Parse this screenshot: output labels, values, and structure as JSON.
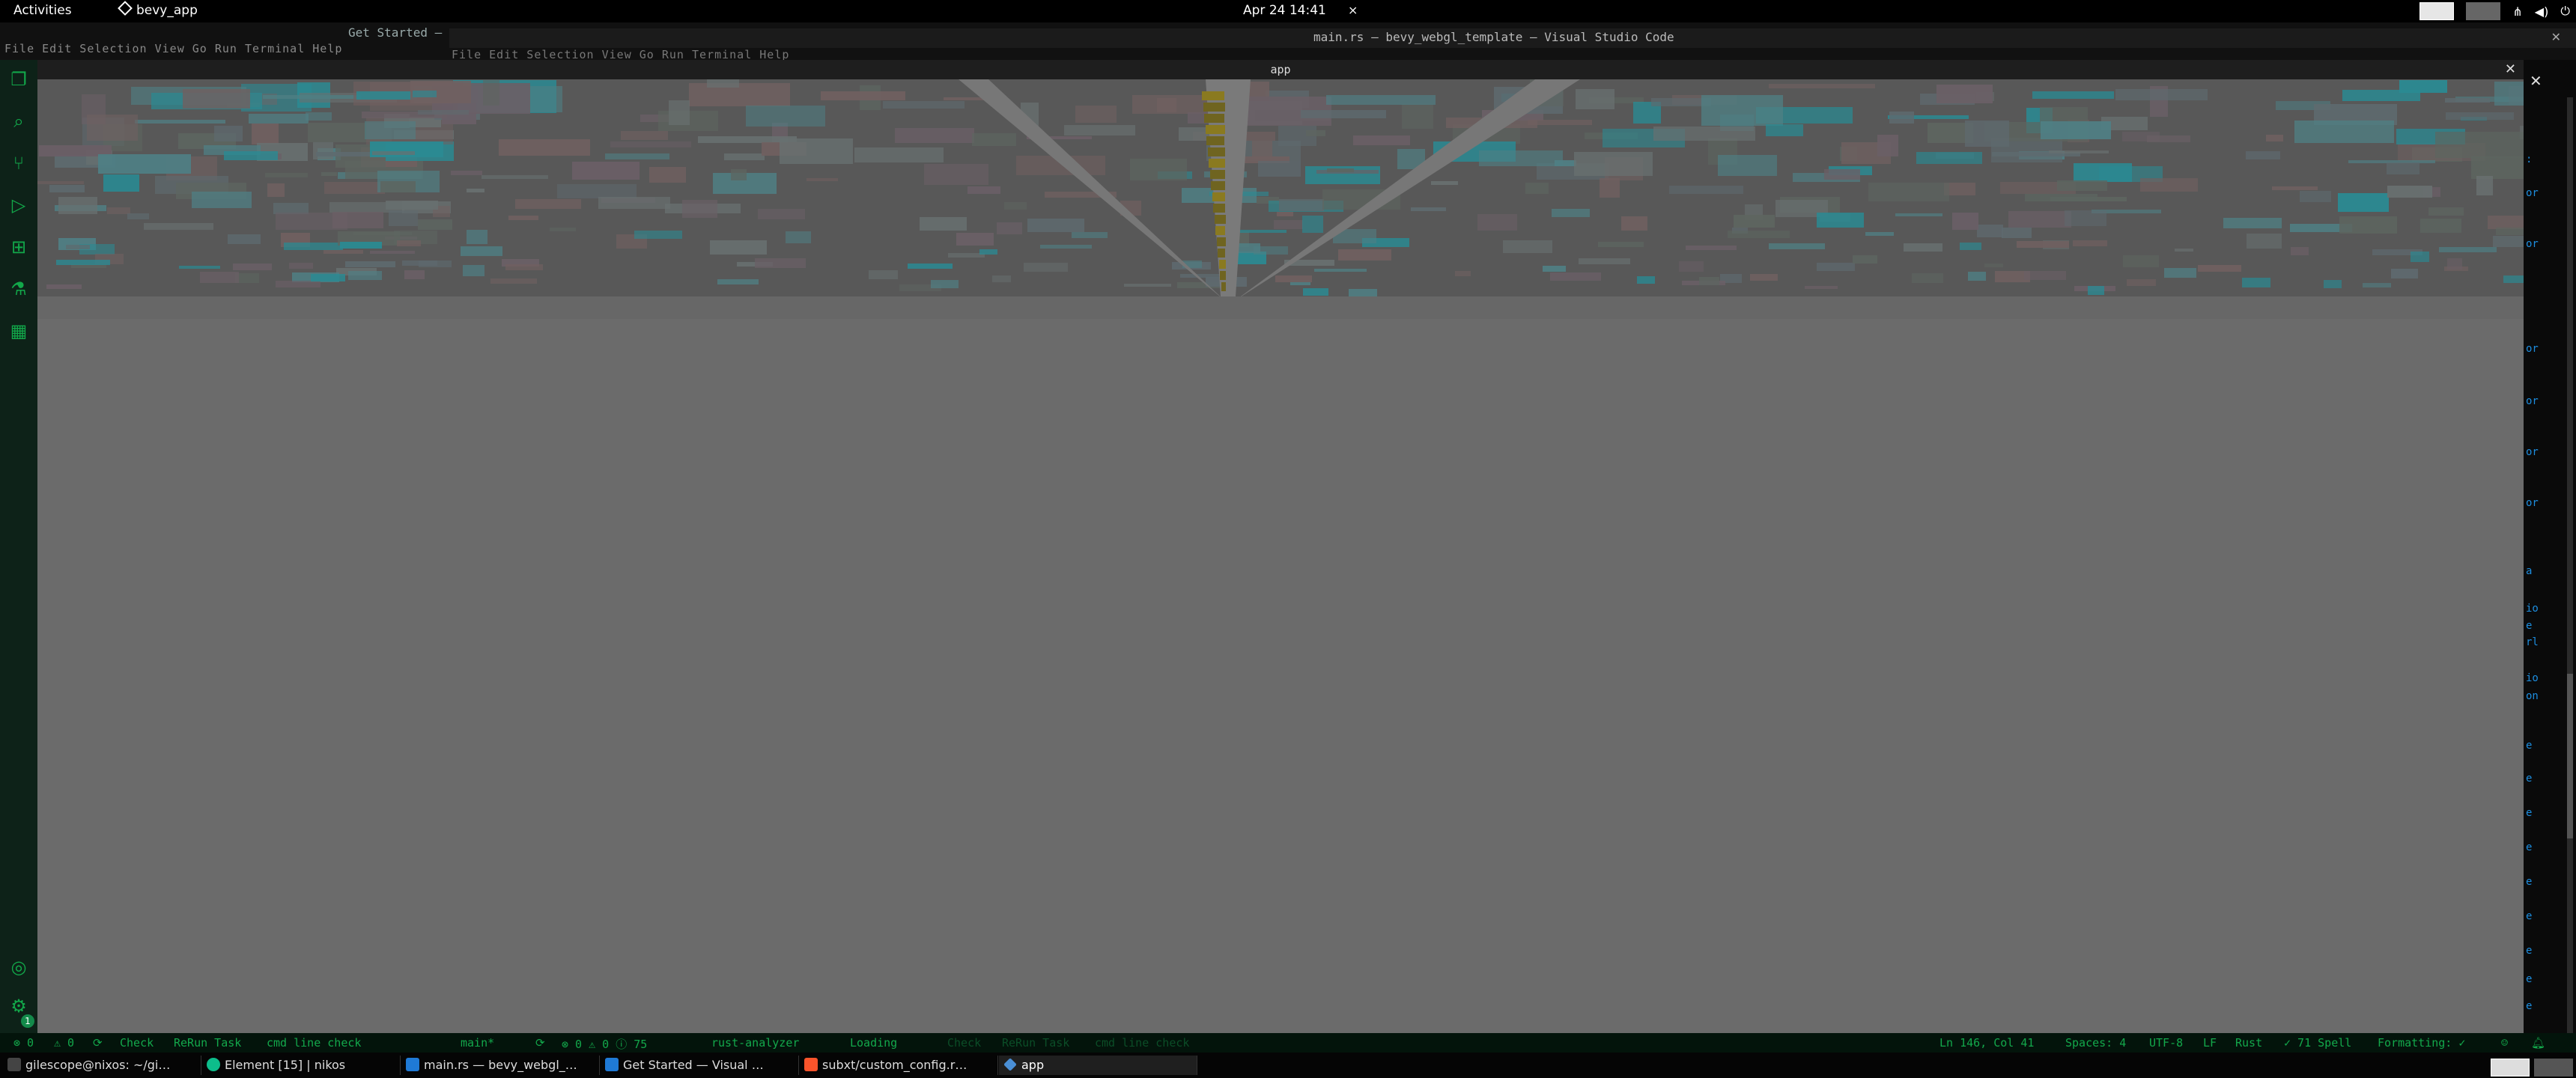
{
  "topbar": {
    "activities": "Activities",
    "app_menu": "bevy_app",
    "clock": "Apr 24 14:41"
  },
  "vscode_back": {
    "title": "Get Started —",
    "menu": "File  Edit  Selection  View  Go  Run  Terminal  Help"
  },
  "vscode_front": {
    "title": "main.rs — bevy_webgl_template — Visual Studio Code",
    "menu": "File  Edit  Selection  View  Go  Run  Terminal  Help"
  },
  "app_window": {
    "title": "app"
  },
  "activity_bar": {
    "items": [
      {
        "name": "explorer-icon",
        "glyph": "❐"
      },
      {
        "name": "search-icon",
        "glyph": "⌕"
      },
      {
        "name": "source-control-icon",
        "glyph": "⑂"
      },
      {
        "name": "run-debug-icon",
        "glyph": "▷"
      },
      {
        "name": "extensions-icon",
        "glyph": "⊞"
      },
      {
        "name": "testing-icon",
        "glyph": "⚗"
      },
      {
        "name": "remote-icon",
        "glyph": "▦"
      }
    ],
    "account_glyph": "◎",
    "settings_glyph": "⚙",
    "settings_badge": "1"
  },
  "status_bar": {
    "errors": "⊗ 0",
    "warnings": "⚠ 0",
    "check": "Check",
    "rerun": "ReRun Task",
    "cmd_check": "cmd line check",
    "branch": "main*",
    "sync": "⟳",
    "problems": "⊗ 0 ⚠ 0 ⓘ 75",
    "rust_analyzer": "rust-analyzer",
    "loading": "Loading",
    "check_faint": "Check",
    "rerun_faint": "ReRun Task",
    "cmd_faint": "cmd line check",
    "position": "Ln 146, Col 41",
    "spaces": "Spaces: 4",
    "encoding": "UTF-8",
    "eol": "LF",
    "language": "Rust",
    "spell": "✓ 71 Spell",
    "formatting": "Formatting: ✓"
  },
  "taskbar": {
    "items": [
      {
        "label": "gilescope@nixos: ~/gi…",
        "icon_color": "#444",
        "icon": "terminal-icon"
      },
      {
        "label": "Element [15] | nikos",
        "icon_color": "#0dbd8b",
        "icon": "element-icon"
      },
      {
        "label": "main.rs — bevy_webgl_…",
        "icon_color": "#1f7ad6",
        "icon": "vscode-icon"
      },
      {
        "label": "Get Started — Visual …",
        "icon_color": "#1f7ad6",
        "icon": "vscode-icon"
      },
      {
        "label": "subxt/custom_config.r…",
        "icon_color": "#fb542b",
        "icon": "brave-icon"
      },
      {
        "label": "app",
        "icon_color": "#4a8fd6",
        "icon": "app-icon"
      }
    ]
  },
  "right_code": [
    ":",
    "or",
    "or",
    "or",
    "or",
    "or",
    "or",
    "a",
    "io",
    "e",
    "rl",
    "io",
    "on",
    "e",
    "e",
    "e",
    "e",
    "e",
    "e",
    "e",
    "e",
    "e"
  ]
}
